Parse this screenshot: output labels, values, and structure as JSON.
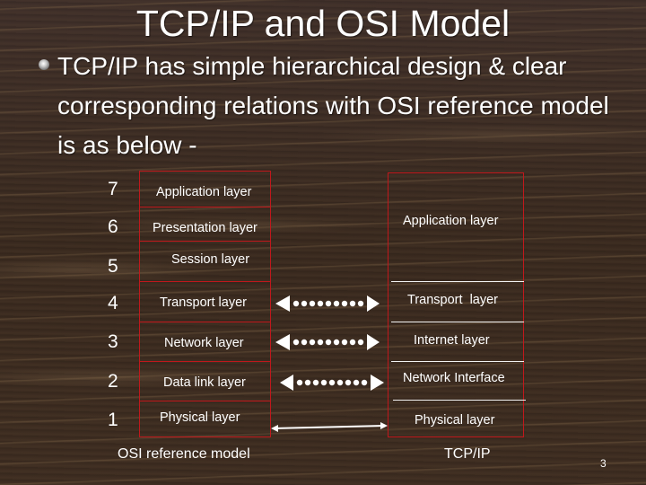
{
  "slide": {
    "title": "TCP/IP and OSI Model",
    "bullet": "TCP/IP has simple hierarchical design & clear corresponding relations with OSI reference model is as below -",
    "page_number": "3"
  },
  "diagram": {
    "osi": {
      "caption": "OSI reference model",
      "layers": [
        {
          "number": "7",
          "label": "Application layer"
        },
        {
          "number": "6",
          "label": "Presentation layer"
        },
        {
          "number": "5",
          "label": "Session layer"
        },
        {
          "number": "4",
          "label": "Transport layer"
        },
        {
          "number": "3",
          "label": "Network layer"
        },
        {
          "number": "2",
          "label": "Data link layer"
        },
        {
          "number": "1",
          "label": "Physical layer"
        }
      ]
    },
    "tcpip": {
      "caption": "TCP/IP",
      "layers": [
        {
          "label": "Application layer",
          "maps_to_osi": [
            "7",
            "6",
            "5"
          ]
        },
        {
          "label": "Transport  layer",
          "maps_to_osi": [
            "4"
          ]
        },
        {
          "label": "Internet layer",
          "maps_to_osi": [
            "3"
          ]
        },
        {
          "label": "Network Interface",
          "maps_to_osi": [
            "2"
          ]
        },
        {
          "label": "Physical layer",
          "maps_to_osi": [
            "1"
          ]
        }
      ]
    },
    "arrows": [
      {
        "from": "Transport layer",
        "to": "Transport  layer",
        "style": "dotted-double"
      },
      {
        "from": "Network layer",
        "to": "Internet layer",
        "style": "dotted-double"
      },
      {
        "from": "Data link layer",
        "to": "Network Interface",
        "style": "dotted-double"
      },
      {
        "from": "Physical layer",
        "to": "Physical layer",
        "style": "thin-double"
      }
    ],
    "colors": {
      "osi_border": "#c0181c",
      "tcp_border": "#c0181c",
      "tcp_dividers": "#f2f2f2",
      "text": "#ffffff",
      "background": "#3b2a1f"
    }
  }
}
